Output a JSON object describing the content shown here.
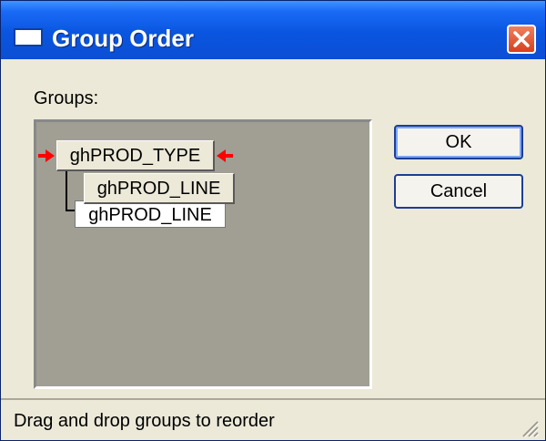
{
  "window": {
    "title": "Group Order"
  },
  "groups_label": "Groups:",
  "tree": {
    "root": "ghPROD_TYPE",
    "child": "ghPROD_LINE",
    "drag_item": "ghPROD_LINE"
  },
  "buttons": {
    "ok": "OK",
    "cancel": "Cancel"
  },
  "status": "Drag and drop groups to reorder",
  "colors": {
    "arrow": "#ff0000",
    "panel": "#a19e93",
    "title_bar": "#0b4fd3"
  }
}
